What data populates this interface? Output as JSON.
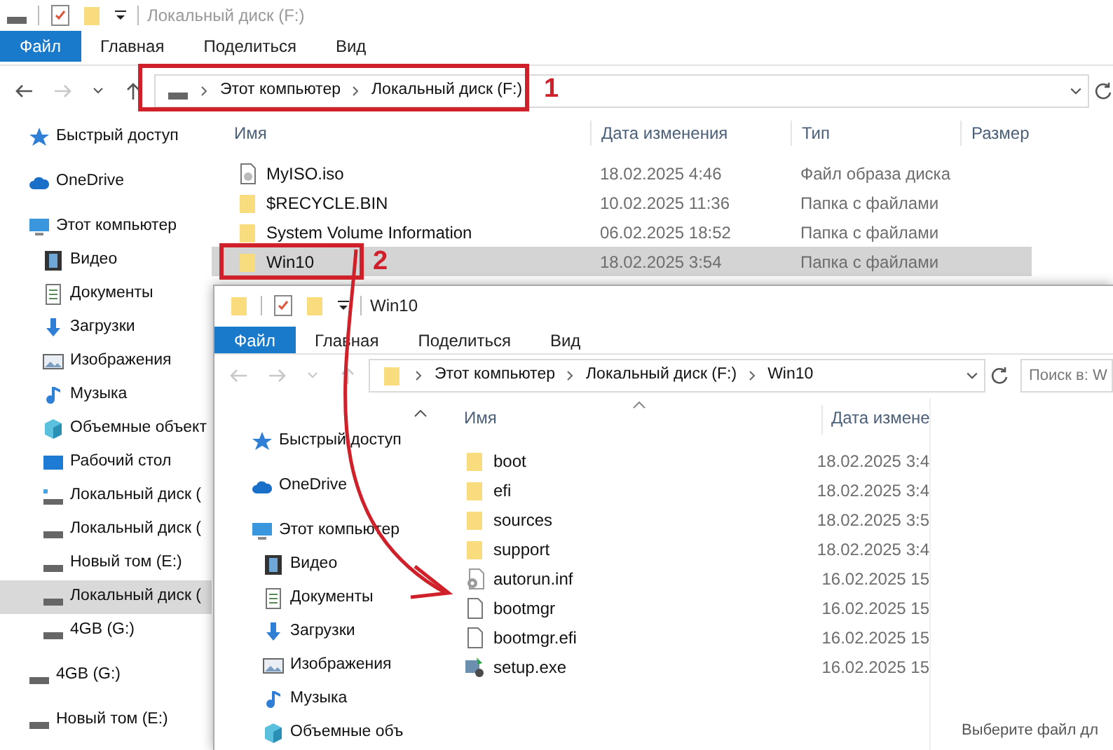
{
  "back_window": {
    "title": "Локальный диск (F:)",
    "tabs": [
      {
        "label": "Файл",
        "selected": true
      },
      {
        "label": "Главная",
        "selected": false
      },
      {
        "label": "Поделиться",
        "selected": false
      },
      {
        "label": "Вид",
        "selected": false
      }
    ],
    "address": [
      "Этот компьютер",
      "Локальный диск (F:)"
    ],
    "nav": [
      {
        "label": "Быстрый доступ",
        "kind": "star",
        "selected": false
      },
      {
        "label": "OneDrive",
        "kind": "cloud",
        "selected": false
      },
      {
        "label": "Этот компьютер",
        "kind": "pc",
        "selected": false,
        "children": [
          {
            "label": "Видео",
            "kind": "video",
            "selected": false
          },
          {
            "label": "Документы",
            "kind": "docs",
            "selected": false
          },
          {
            "label": "Загрузки",
            "kind": "download",
            "selected": false
          },
          {
            "label": "Изображения",
            "kind": "images",
            "selected": false
          },
          {
            "label": "Музыка",
            "kind": "music",
            "selected": false
          },
          {
            "label": "Объемные объект",
            "kind": "cube",
            "selected": false
          },
          {
            "label": "Рабочий стол",
            "kind": "desktop",
            "selected": false
          },
          {
            "label": "Локальный диск (",
            "kind": "sysdrive",
            "selected": false
          },
          {
            "label": "Локальный диск (",
            "kind": "drive",
            "selected": false
          },
          {
            "label": "Новый том (E:)",
            "kind": "drive",
            "selected": false
          },
          {
            "label": "Локальный диск (",
            "kind": "drive",
            "selected": true
          },
          {
            "label": "4GB (G:)",
            "kind": "drive",
            "selected": false
          }
        ]
      },
      {
        "label": "4GB (G:)",
        "kind": "drive",
        "selected": false
      },
      {
        "label": "Новый том (E:)",
        "kind": "drive",
        "selected": false
      }
    ],
    "columns": [
      "Имя",
      "Дата изменения",
      "Тип",
      "Размер"
    ],
    "files": [
      {
        "name": "MyISO.iso",
        "kind": "iso",
        "date": "18.02.2025 4:46",
        "type": "Файл образа диска",
        "selected": false
      },
      {
        "name": "$RECYCLE.BIN",
        "kind": "folder",
        "date": "10.02.2025 11:36",
        "type": "Папка с файлами",
        "selected": false
      },
      {
        "name": "System Volume Information",
        "kind": "folder",
        "date": "06.02.2025 18:52",
        "type": "Папка с файлами",
        "selected": false
      },
      {
        "name": "Win10",
        "kind": "folder",
        "date": "18.02.2025 3:54",
        "type": "Папка с файлами",
        "selected": true,
        "annotation": "2"
      }
    ]
  },
  "front_window": {
    "title": "Win10",
    "tabs": [
      {
        "label": "Файл",
        "selected": true
      },
      {
        "label": "Главная",
        "selected": false
      },
      {
        "label": "Поделиться",
        "selected": false
      },
      {
        "label": "Вид",
        "selected": false
      }
    ],
    "address": [
      "Этот компьютер",
      "Локальный диск (F:)",
      "Win10"
    ],
    "search": {
      "placeholder": "Поиск в: W"
    },
    "nav": [
      {
        "label": "Быстрый доступ",
        "kind": "star",
        "selected": false
      },
      {
        "label": "OneDrive",
        "kind": "cloud",
        "selected": false
      },
      {
        "label": "Этот компьютер",
        "kind": "pc",
        "selected": false,
        "children": [
          {
            "label": "Видео",
            "kind": "video",
            "selected": false
          },
          {
            "label": "Документы",
            "kind": "docs",
            "selected": false
          },
          {
            "label": "Загрузки",
            "kind": "download",
            "selected": false
          },
          {
            "label": "Изображения",
            "kind": "images",
            "selected": false
          },
          {
            "label": "Музыка",
            "kind": "music",
            "selected": false
          },
          {
            "label": "Объемные объ",
            "kind": "cube",
            "selected": false
          }
        ]
      }
    ],
    "columns": [
      "Имя",
      "Дата измене"
    ],
    "files": [
      {
        "name": "boot",
        "kind": "folder",
        "date": "18.02.2025 3:4",
        "selected": false
      },
      {
        "name": "efi",
        "kind": "folder",
        "date": "18.02.2025 3:4",
        "selected": false
      },
      {
        "name": "sources",
        "kind": "folder",
        "date": "18.02.2025 3:5",
        "selected": false
      },
      {
        "name": "support",
        "kind": "folder",
        "date": "18.02.2025 3:4",
        "selected": false
      },
      {
        "name": "autorun.inf",
        "kind": "gear",
        "date": "16.02.2025 15",
        "selected": false
      },
      {
        "name": "bootmgr",
        "kind": "file",
        "date": "16.02.2025 15",
        "selected": false
      },
      {
        "name": "bootmgr.efi",
        "kind": "file",
        "date": "16.02.2025 15",
        "selected": false
      },
      {
        "name": "setup.exe",
        "kind": "setup",
        "date": "16.02.2025 15",
        "selected": false
      }
    ],
    "details_hint": "Выберите файл дл"
  },
  "annotations": [
    {
      "label": "1"
    }
  ]
}
